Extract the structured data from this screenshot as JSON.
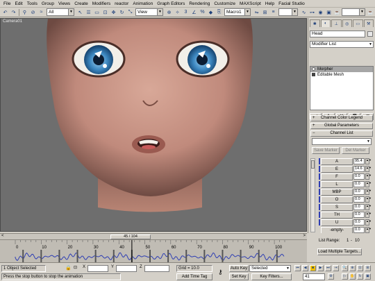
{
  "menu": [
    "File",
    "Edit",
    "Tools",
    "Group",
    "Views",
    "Create",
    "Modifiers",
    "reactor",
    "Animation",
    "Graph Editors",
    "Rendering",
    "Customize",
    "MAXScript",
    "Help",
    "Facial Studio"
  ],
  "toolbar": {
    "selection_filter": "All",
    "reference_coord": "View",
    "named_selection": "Macro1"
  },
  "viewport": {
    "label": "Camera01"
  },
  "command_panel": {
    "tabs": [
      "create",
      "modify",
      "hierarchy",
      "motion",
      "display",
      "utilities"
    ],
    "object_name": "Head",
    "modifier_list": "Modifier List",
    "stack": [
      "Morpher",
      "Editable Mesh"
    ],
    "rollouts": {
      "color_legend": "Channel Color Legend",
      "global_params": "Global Parameters",
      "channel_list": "Channel List"
    },
    "save_marker": "Save Marker",
    "del_marker": "Del Marker",
    "channels": [
      {
        "label": "A",
        "value": "95.4"
      },
      {
        "label": "E",
        "value": "14.6"
      },
      {
        "label": "F",
        "value": "0.0"
      },
      {
        "label": "L",
        "value": "0.0"
      },
      {
        "label": "MBP",
        "value": "0.0"
      },
      {
        "label": "O",
        "value": "0.0"
      },
      {
        "label": "S",
        "value": "0.0"
      },
      {
        "label": "TH",
        "value": "0.0"
      },
      {
        "label": "U",
        "value": "0.0"
      },
      {
        "label": "-empty-",
        "value": "0.0"
      }
    ],
    "list_range": "List Range:",
    "list_range_from": "1",
    "list_range_to": "10",
    "load_multiple": "Load Multiple Targets..."
  },
  "timeline": {
    "slider_text": "45 / 104",
    "current_frame": 45,
    "total_frames": 104,
    "ticks": [
      "0",
      "10",
      "20",
      "30",
      "40",
      "50",
      "60",
      "70",
      "80",
      "90",
      "100"
    ]
  },
  "status": {
    "selection": "1 Object Selected",
    "prompt": "Press the stop button to stop the animation",
    "grid": "Grid = 10.0",
    "add_time_tag": "Add Time Tag",
    "auto_key": "Auto Key",
    "set_key": "Set Key",
    "key_mode": "Selected",
    "key_filters": "Key Filters...",
    "frame": "41"
  },
  "colors": {
    "accent": "#2f3fb3",
    "ui_gray": "#d4d0c8",
    "viewport": "#6e6e6e",
    "active_play": "#f0c000"
  }
}
